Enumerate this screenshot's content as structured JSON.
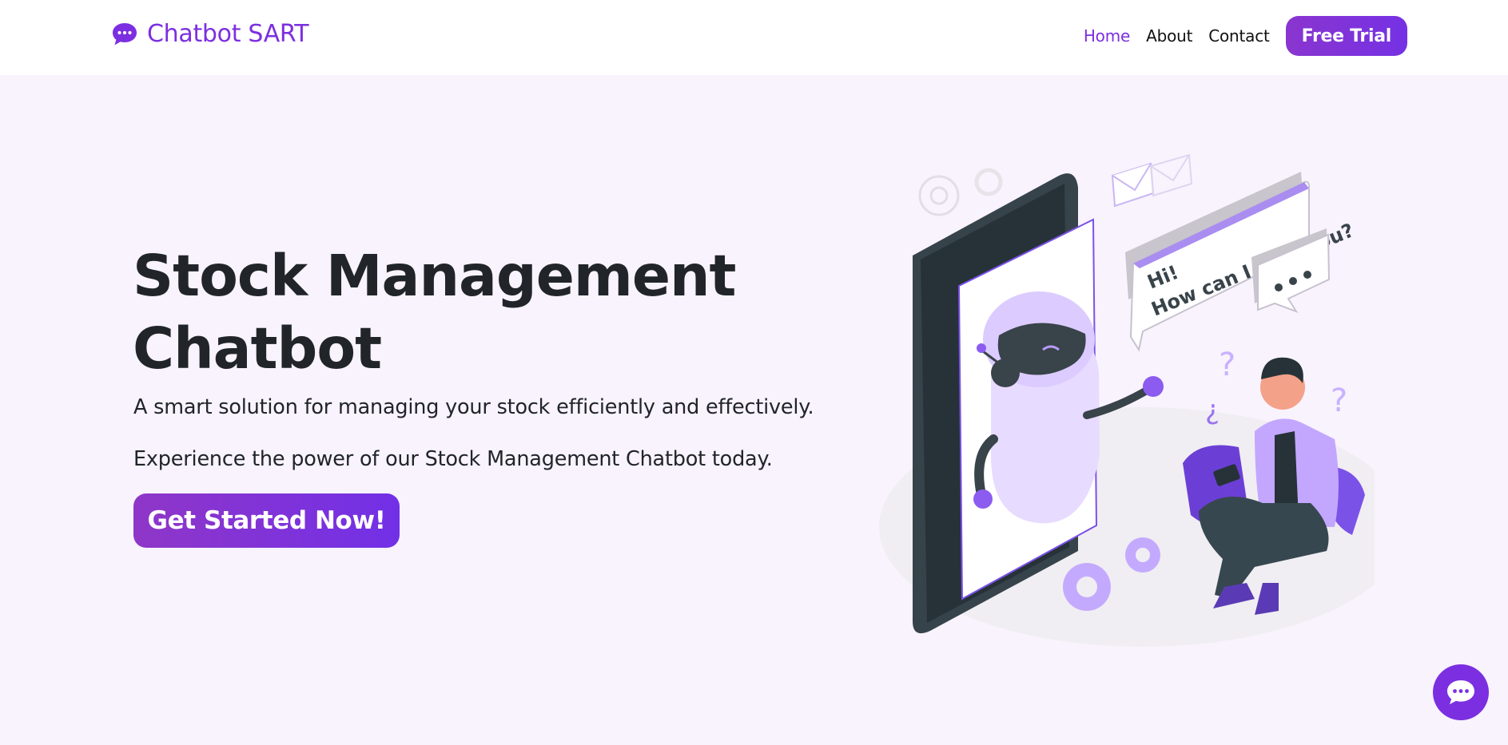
{
  "brand": {
    "name": "Chatbot SART",
    "icon": "chat-bubble-icon",
    "color": "#7c2fe0"
  },
  "nav": {
    "links": [
      {
        "label": "Home",
        "active": true
      },
      {
        "label": "About",
        "active": false
      },
      {
        "label": "Contact",
        "active": false
      }
    ],
    "cta_label": "Free Trial"
  },
  "hero": {
    "title_line1": "Stock Management",
    "title_line2": "Chatbot",
    "subtitle": "A smart solution for managing your stock efficiently and effectively.",
    "tagline": "Experience the power of our Stock Management Chatbot today.",
    "cta_label": "Get Started Now!"
  },
  "illustration": {
    "bubble_line1": "Hi!",
    "bubble_line2": "How can I help you?"
  },
  "chat_widget": {
    "icon": "chat-bubble-icon"
  },
  "colors": {
    "accent": "#7c2fe0",
    "page_background": "#f8f3fd",
    "header_background": "#ffffff",
    "text": "#212529"
  }
}
